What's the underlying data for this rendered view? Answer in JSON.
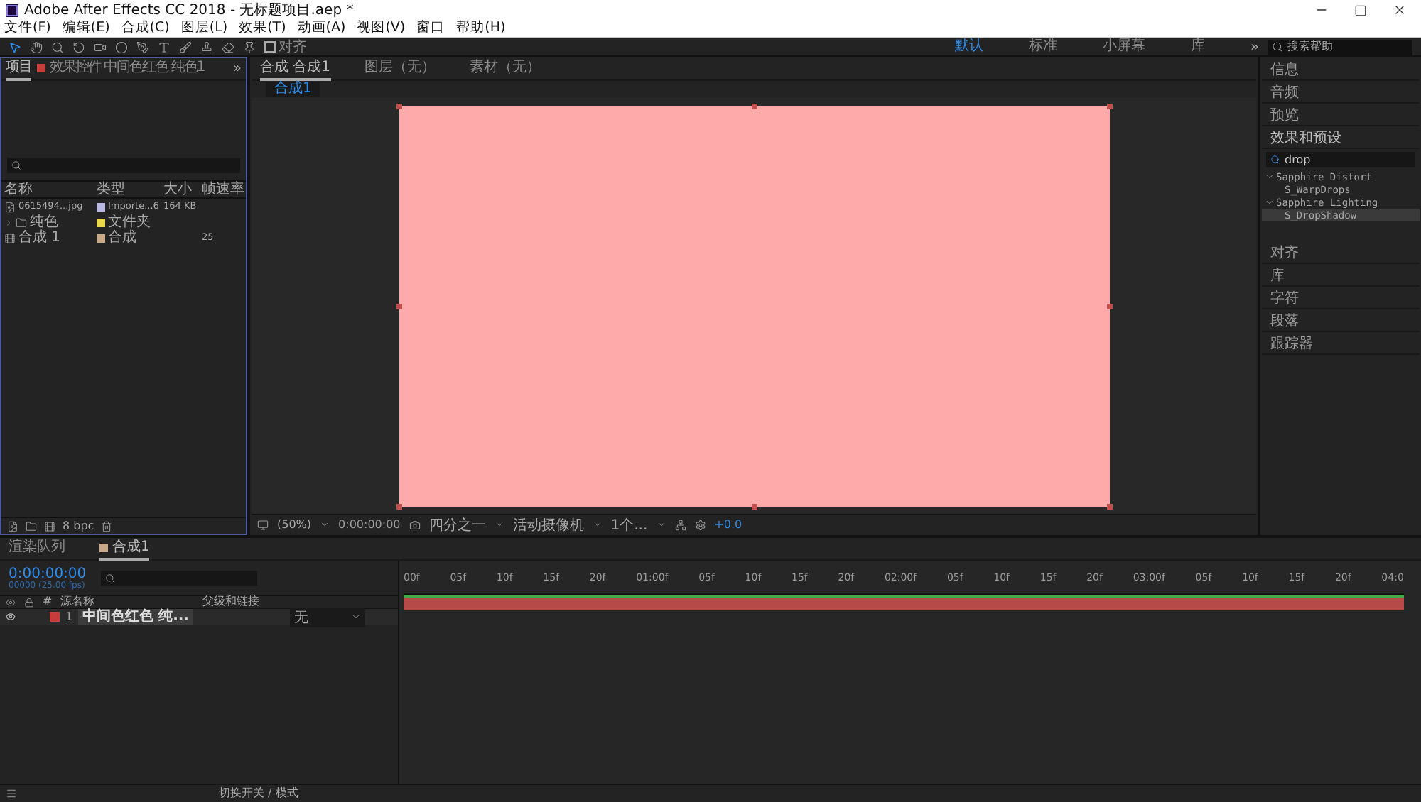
{
  "window": {
    "title": "Adobe After Effects CC 2018 - 无标题项目.aep *"
  },
  "menu": [
    "文件(F)",
    "编辑(E)",
    "合成(C)",
    "图层(L)",
    "效果(T)",
    "动画(A)",
    "视图(V)",
    "窗口",
    "帮助(H)"
  ],
  "toolbar": {
    "align": {
      "label": "对齐",
      "checked": false
    },
    "workspaces": [
      {
        "label": "默认",
        "selected": true
      },
      {
        "label": "标准",
        "selected": false
      },
      {
        "label": "小屏幕",
        "selected": false
      },
      {
        "label": "库",
        "selected": false
      }
    ],
    "more": "»",
    "search": {
      "placeholder": "搜索帮助"
    }
  },
  "project_panel": {
    "tabs": [
      {
        "label": "项目",
        "selected": true,
        "kind": "plain"
      },
      {
        "label": "效果控件 中间色红色 纯色1",
        "selected": false,
        "kind": "effect"
      }
    ],
    "more": "»",
    "columns": [
      "名称",
      "类型",
      "大小",
      "帧速率"
    ],
    "items": [
      {
        "kind": "footage",
        "name": "0615494...jpg",
        "color": "#b8b8e0",
        "type": "Importe...6",
        "size": "164 KB"
      },
      {
        "kind": "folder",
        "name": "纯色",
        "color": "#e8d84a",
        "type": "文件夹"
      },
      {
        "kind": "comp",
        "name": "合成 1",
        "color": "#c8aa88",
        "type": "合成",
        "rate": "25"
      }
    ],
    "bpc": "8 bpc"
  },
  "viewer": {
    "tabs": [
      {
        "label": "合成 合成1",
        "selected": true
      },
      {
        "label": "图层（无）",
        "selected": false
      },
      {
        "label": "素材（无）",
        "selected": false
      }
    ],
    "subtab": "合成1",
    "controls": {
      "zoom": "(50%)",
      "time": "0:00:00:00",
      "resolution": "四分之一",
      "camera": "活动摄像机",
      "views": "1个...",
      "exposure": "+0.0"
    }
  },
  "side_panels": [
    {
      "label": "信息",
      "expanded": false
    },
    {
      "label": "音频",
      "expanded": false
    },
    {
      "label": "预览",
      "expanded": false
    },
    {
      "label": "效果和预设",
      "expanded": true,
      "search": "drop",
      "tree": [
        {
          "label": "Sapphire Distort",
          "expanded": true,
          "children": [
            {
              "label": "S_WarpDrops",
              "selected": false
            }
          ]
        },
        {
          "label": "Sapphire Lighting",
          "expanded": true,
          "children": [
            {
              "label": "S_DropShadow",
              "selected": true
            }
          ]
        }
      ]
    },
    {
      "label": "对齐",
      "expanded": false
    },
    {
      "label": "库",
      "expanded": false
    },
    {
      "label": "字符",
      "expanded": false
    },
    {
      "label": "段落",
      "expanded": false
    },
    {
      "label": "跟踪器",
      "expanded": false
    }
  ],
  "timeline": {
    "tabs": [
      {
        "label": "渲染队列",
        "selected": false
      },
      {
        "label": "合成1",
        "selected": true
      }
    ],
    "timecode": "0:00:00:00",
    "fps": "00000 (25.00 fps)",
    "columns": {
      "index": "#",
      "name": "源名称",
      "parent": "父级和链接"
    },
    "layers": [
      {
        "index": "1",
        "name": "中间色红色 纯...",
        "color": "#c83c3c",
        "visible": true,
        "parent": "无"
      }
    ],
    "ruler": [
      "00f",
      "05f",
      "10f",
      "15f",
      "20f",
      "01:00f",
      "05f",
      "10f",
      "15f",
      "20f",
      "02:00f",
      "05f",
      "10f",
      "15f",
      "20f",
      "03:00f",
      "05f",
      "10f",
      "15f",
      "20f",
      "04:0"
    ]
  },
  "status": "切换开关 / 模式"
}
